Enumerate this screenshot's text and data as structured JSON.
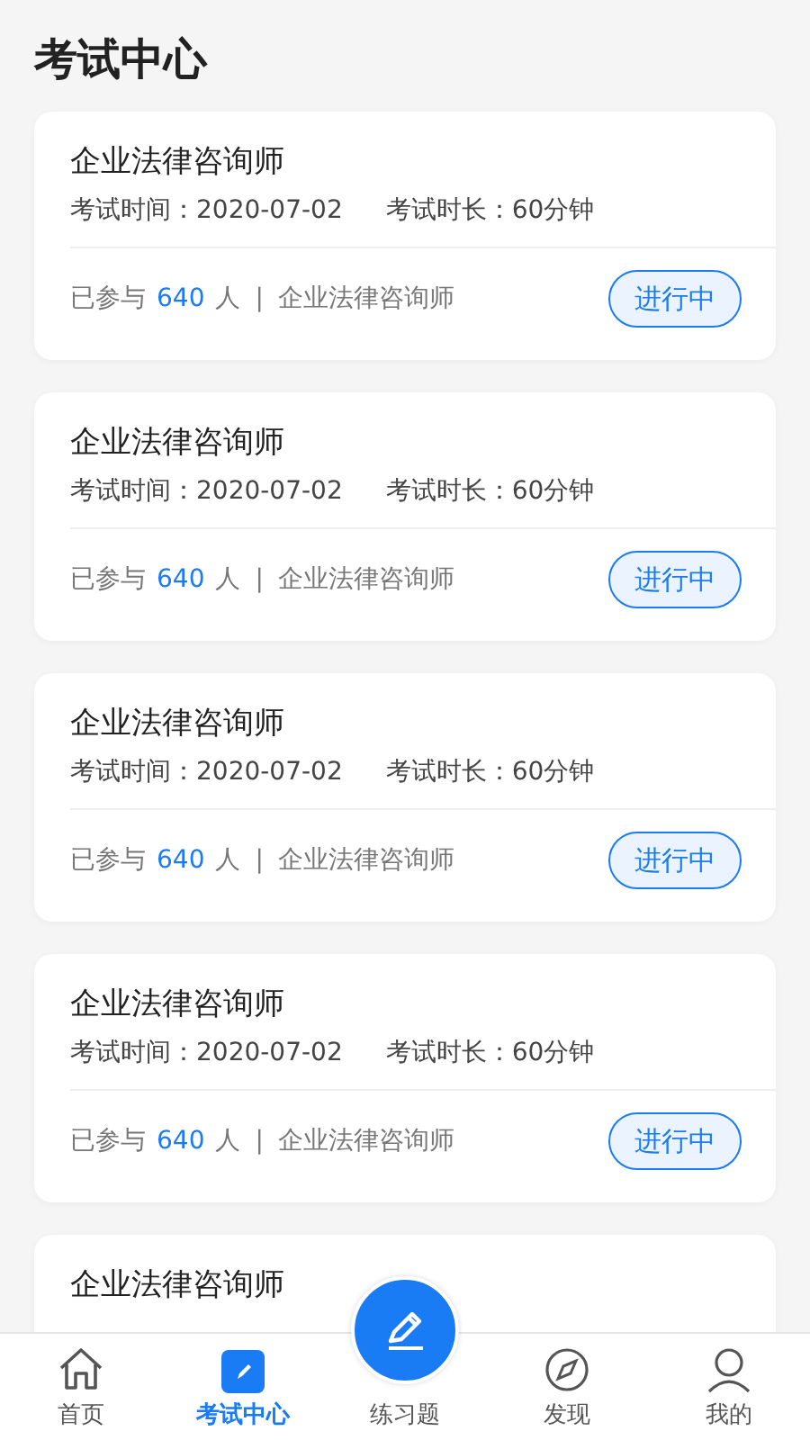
{
  "header": {
    "title": "考试中心"
  },
  "exams": [
    {
      "title": "企业法律咨询师",
      "time_label": "考试时间：",
      "date": "2020-07-02",
      "duration_label": "考试时长：",
      "duration": "60分钟",
      "joined_prefix": "已参与",
      "count": "640",
      "joined_suffix": "人",
      "separator": "|",
      "category": "企业法律咨询师",
      "status": "进行中"
    },
    {
      "title": "企业法律咨询师",
      "time_label": "考试时间：",
      "date": "2020-07-02",
      "duration_label": "考试时长：",
      "duration": "60分钟",
      "joined_prefix": "已参与",
      "count": "640",
      "joined_suffix": "人",
      "separator": "|",
      "category": "企业法律咨询师",
      "status": "进行中"
    },
    {
      "title": "企业法律咨询师",
      "time_label": "考试时间：",
      "date": "2020-07-02",
      "duration_label": "考试时长：",
      "duration": "60分钟",
      "joined_prefix": "已参与",
      "count": "640",
      "joined_suffix": "人",
      "separator": "|",
      "category": "企业法律咨询师",
      "status": "进行中"
    },
    {
      "title": "企业法律咨询师",
      "time_label": "考试时间：",
      "date": "2020-07-02",
      "duration_label": "考试时长：",
      "duration": "60分钟",
      "joined_prefix": "已参与",
      "count": "640",
      "joined_suffix": "人",
      "separator": "|",
      "category": "企业法律咨询师",
      "status": "进行中"
    },
    {
      "title": "企业法律咨询师"
    }
  ],
  "tab_bar": [
    {
      "label": "首页",
      "kind": "tab",
      "selected": false
    },
    {
      "label": "考试中心",
      "kind": "tab",
      "selected": true
    },
    {
      "label": "练习题",
      "kind": "center",
      "selected": false
    },
    {
      "label": "发现",
      "kind": "tab",
      "selected": false
    },
    {
      "label": "我的",
      "kind": "tab",
      "selected": false
    }
  ]
}
